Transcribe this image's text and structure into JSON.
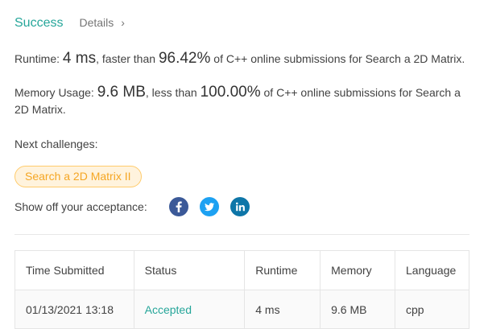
{
  "header": {
    "title": "Success",
    "details_label": "Details",
    "details_chevron": "›"
  },
  "runtime": {
    "prefix": "Runtime: ",
    "value": "4 ms",
    "mid": ", faster than ",
    "percent": "96.42%",
    "suffix": " of C++ online submissions for Search a 2D Matrix."
  },
  "memory": {
    "prefix": "Memory Usage: ",
    "value": "9.6 MB",
    "mid": ", less than ",
    "percent": "100.00%",
    "suffix": " of C++ online submissions for Search a 2D Matrix."
  },
  "next_challenges": {
    "label": "Next challenges:",
    "items": [
      "Search a 2D Matrix II"
    ]
  },
  "share": {
    "label": "Show off your acceptance:",
    "icons": [
      "facebook-icon",
      "twitter-icon",
      "linkedin-icon"
    ]
  },
  "table": {
    "headers": [
      "Time Submitted",
      "Status",
      "Runtime",
      "Memory",
      "Language"
    ],
    "rows": [
      {
        "time": "01/13/2021 13:18",
        "status": "Accepted",
        "runtime": "4 ms",
        "memory": "9.6 MB",
        "language": "cpp"
      }
    ]
  },
  "colors": {
    "success": "#26a69a",
    "chip_text": "#f5a623",
    "chip_bg": "#fff3dd",
    "facebook": "#3b5998",
    "twitter": "#1da1f2",
    "linkedin": "#0e76a8"
  }
}
